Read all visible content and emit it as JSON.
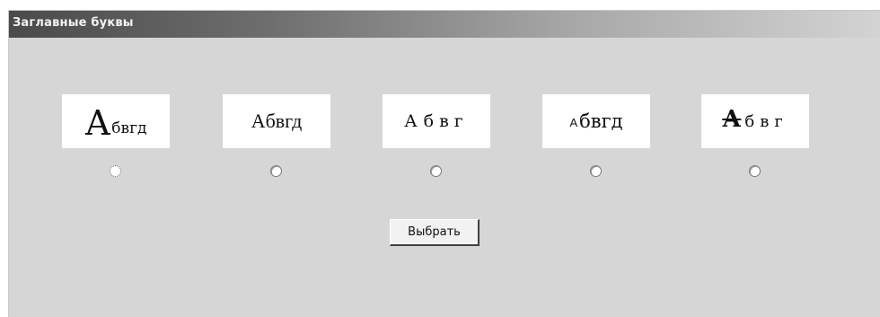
{
  "window": {
    "title": "Заглавные буквы"
  },
  "options": [
    {
      "cap": "А",
      "rest": "бвгд",
      "selected": true
    },
    {
      "cap": "А",
      "rest": "бвгд",
      "selected": false
    },
    {
      "cap": "А",
      "rest": "бвг",
      "selected": false
    },
    {
      "cap": "А",
      "rest": "бвгд",
      "selected": false
    },
    {
      "cap": "А",
      "rest": "бвг",
      "selected": false
    }
  ],
  "actions": {
    "submit_label": "Выбрать"
  },
  "colors": {
    "window_bg": "#d6d6d6",
    "titlebar_dark": "#4a4a4a",
    "titlebar_light": "#d3d3d3",
    "sample_bg": "#ffffff"
  }
}
